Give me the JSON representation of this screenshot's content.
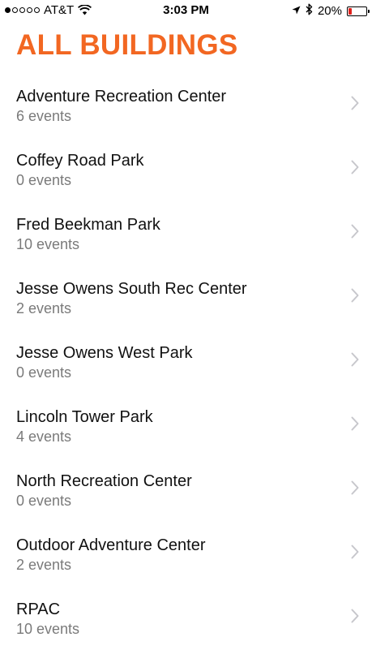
{
  "status_bar": {
    "signal_strength": 1,
    "signal_max": 5,
    "carrier": "AT&T",
    "time": "3:03 PM",
    "battery": "20%",
    "battery_level": 0.2,
    "battery_color": "#e0211c"
  },
  "header": {
    "title": "ALL BUILDINGS",
    "title_color": "#f26722"
  },
  "buildings": [
    {
      "name": "Adventure Recreation Center",
      "events": "6 events"
    },
    {
      "name": "Coffey Road Park",
      "events": "0 events"
    },
    {
      "name": "Fred Beekman Park",
      "events": "10 events"
    },
    {
      "name": "Jesse Owens South Rec Center",
      "events": "2 events"
    },
    {
      "name": "Jesse Owens West Park",
      "events": "0 events"
    },
    {
      "name": "Lincoln Tower Park",
      "events": "4 events"
    },
    {
      "name": "North Recreation Center",
      "events": "0 events"
    },
    {
      "name": "Outdoor Adventure Center",
      "events": "2 events"
    },
    {
      "name": "RPAC",
      "events": "10 events"
    }
  ],
  "icons": {
    "wifi": "wifi-icon",
    "location": "location-arrow-icon",
    "bluetooth": "bluetooth-icon",
    "battery": "battery-icon",
    "row_chevron": "chevron-right-icon"
  }
}
